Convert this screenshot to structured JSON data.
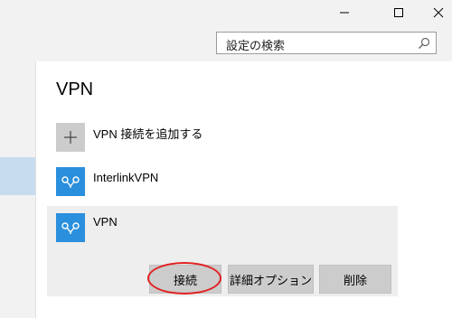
{
  "window": {
    "minimize_icon": "minimize-icon",
    "maximize_icon": "maximize-icon",
    "close_icon": "close-icon"
  },
  "search": {
    "placeholder": "設定の検索",
    "icon": "search-icon"
  },
  "page": {
    "title": "VPN"
  },
  "vpn_list": {
    "add_label": "VPN 接続を追加する",
    "connections": [
      {
        "name": "InterlinkVPN",
        "icon": "vpn-icon",
        "selected": false
      },
      {
        "name": "VPN",
        "icon": "vpn-icon",
        "selected": true
      }
    ]
  },
  "actions": {
    "connect_label": "接続",
    "advanced_label": "詳細オプション",
    "remove_label": "削除"
  },
  "colors": {
    "accent": "#2a8fdc",
    "sidebar_selected": "#c8dcef",
    "highlight": "#e02020"
  }
}
